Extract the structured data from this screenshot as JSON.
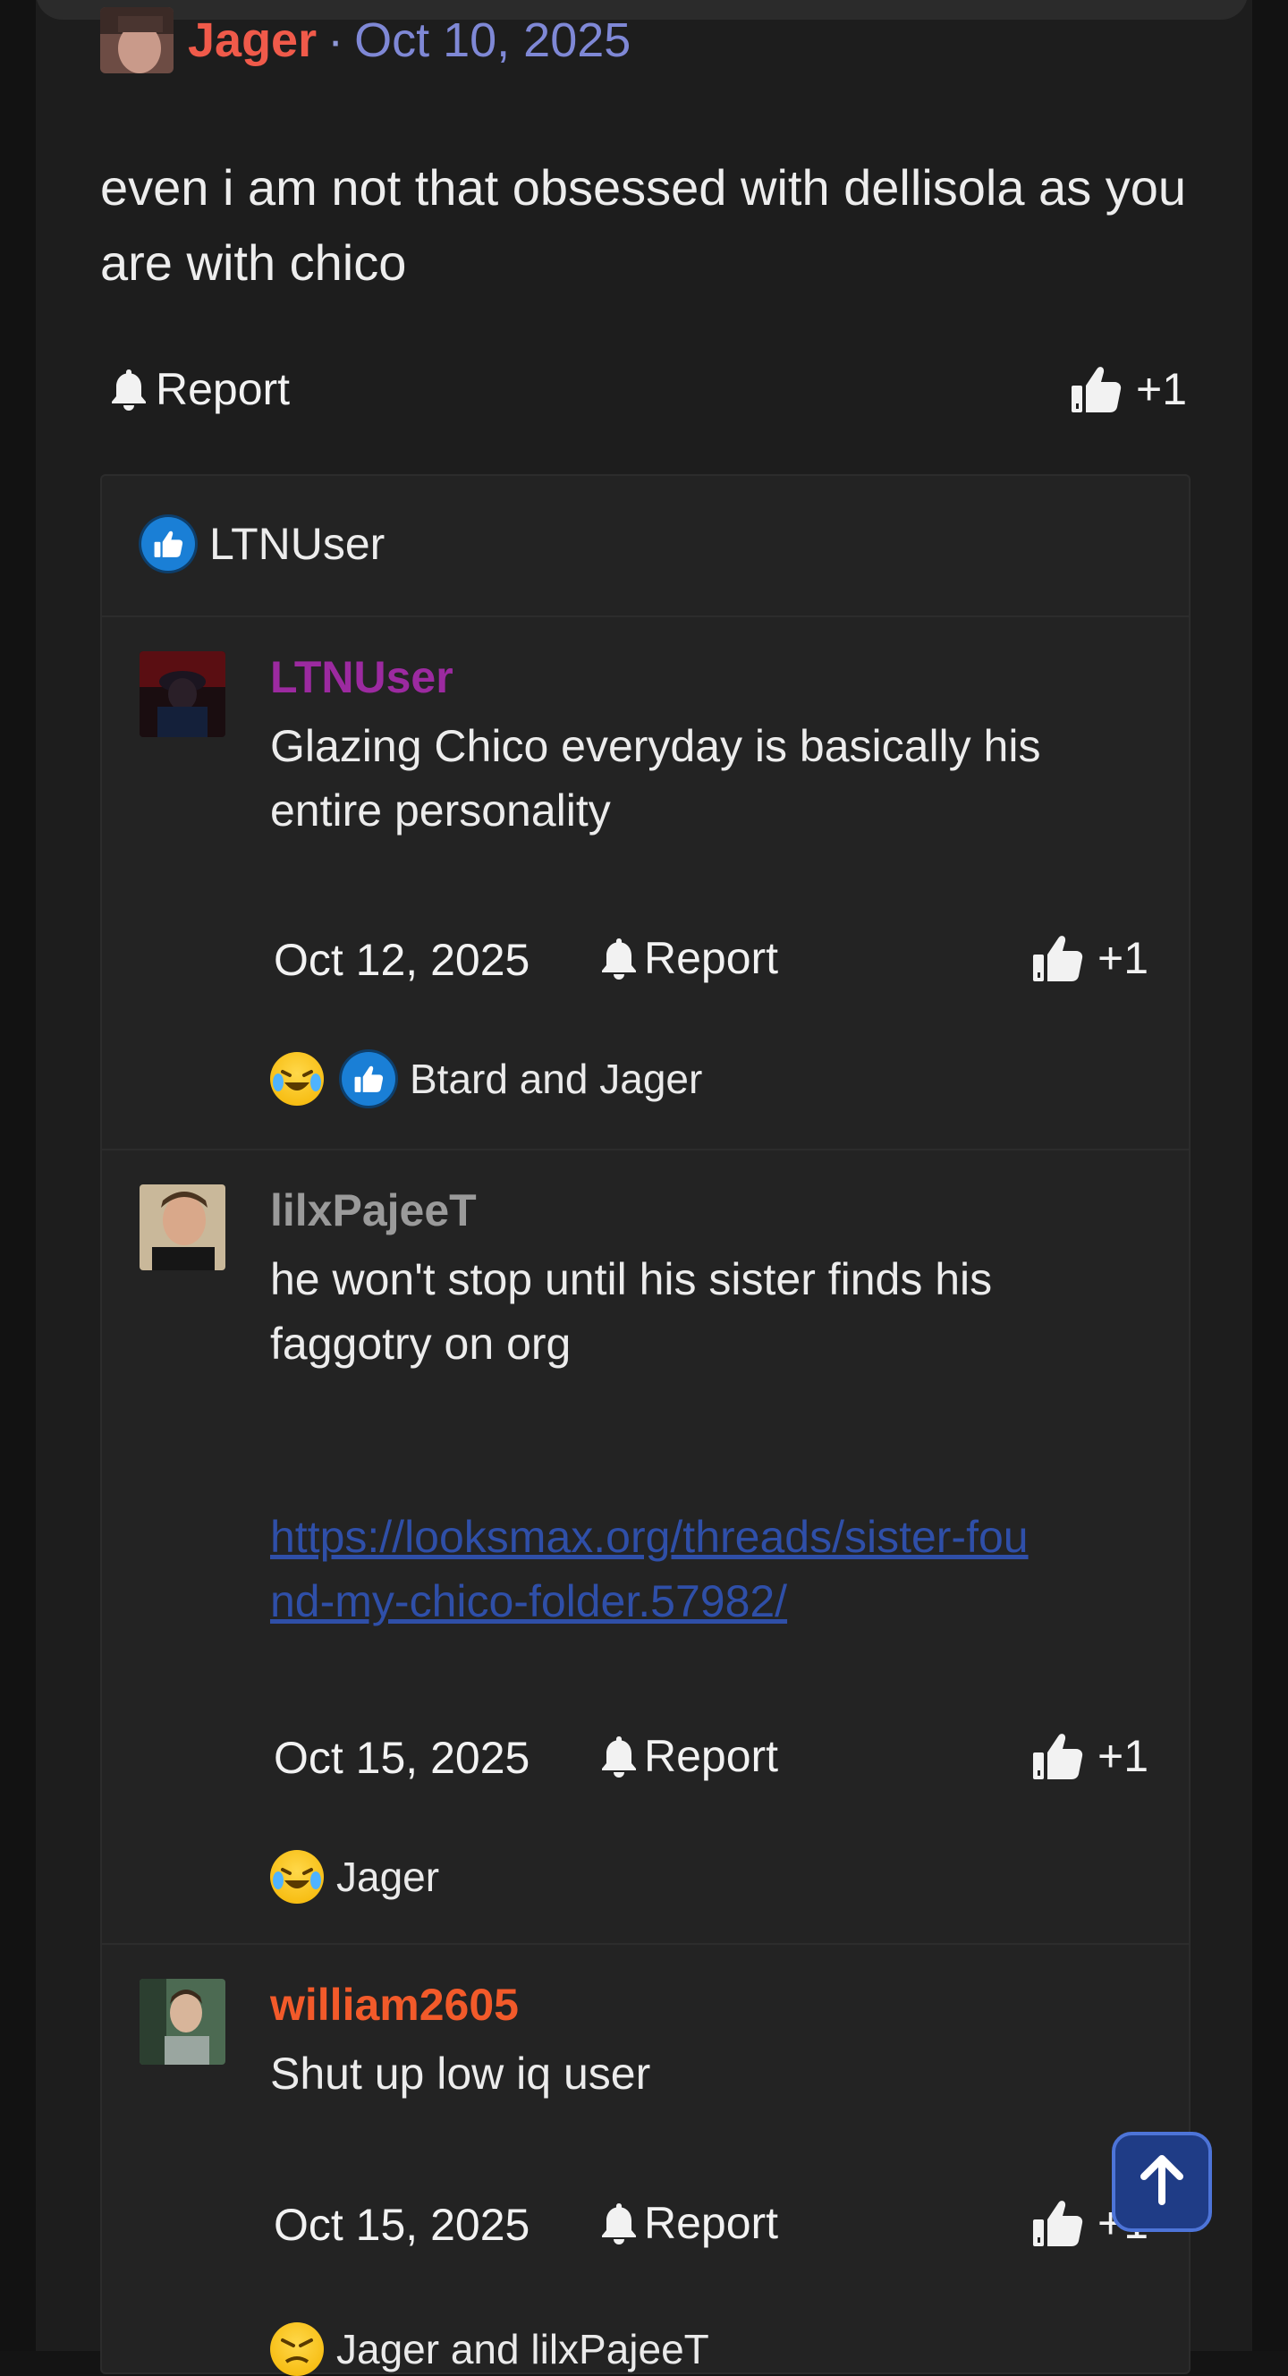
{
  "post": {
    "author": "Jager",
    "separator": "·",
    "date": "Oct 10, 2025",
    "body": "even i am not that obsessed with dellisola as you are with chico",
    "report_label": "Report",
    "like_count": "+1",
    "colors": {
      "author": "#f05a4a",
      "date": "#7f88d6"
    }
  },
  "reactions_summary": {
    "icon": "like-icon",
    "users": "LTNUser"
  },
  "comments": [
    {
      "author": "LTNUser",
      "author_color": "#9c2aa0",
      "text": "Glazing Chico everyday is basically his entire personality",
      "date": "Oct 12, 2025",
      "report_label": "Report",
      "like_count": "+1",
      "reactions": [
        "laugh-icon",
        "like-icon"
      ],
      "reaction_users": "Btard and Jager"
    },
    {
      "author": "lilxPajeeT",
      "author_color": "#9a9a9a",
      "text": "he won't stop until his sister finds his faggotry on org",
      "link": "https://looksmax.org/threads/sister-found-my-chico-folder.57982/",
      "date": "Oct 15, 2025",
      "report_label": "Report",
      "like_count": "+1",
      "reactions": [
        "laugh-icon"
      ],
      "reaction_users": "Jager"
    },
    {
      "author": "william2605",
      "author_color": "#f25a2a",
      "text": "Shut up low iq user",
      "date": "Oct 15, 2025",
      "report_label": "Report",
      "like_count": "+1",
      "reactions": [
        "angry-icon"
      ],
      "reaction_users": "Jager and lilxPajeeT"
    }
  ],
  "scroll_top_icon": "arrow-up-icon"
}
